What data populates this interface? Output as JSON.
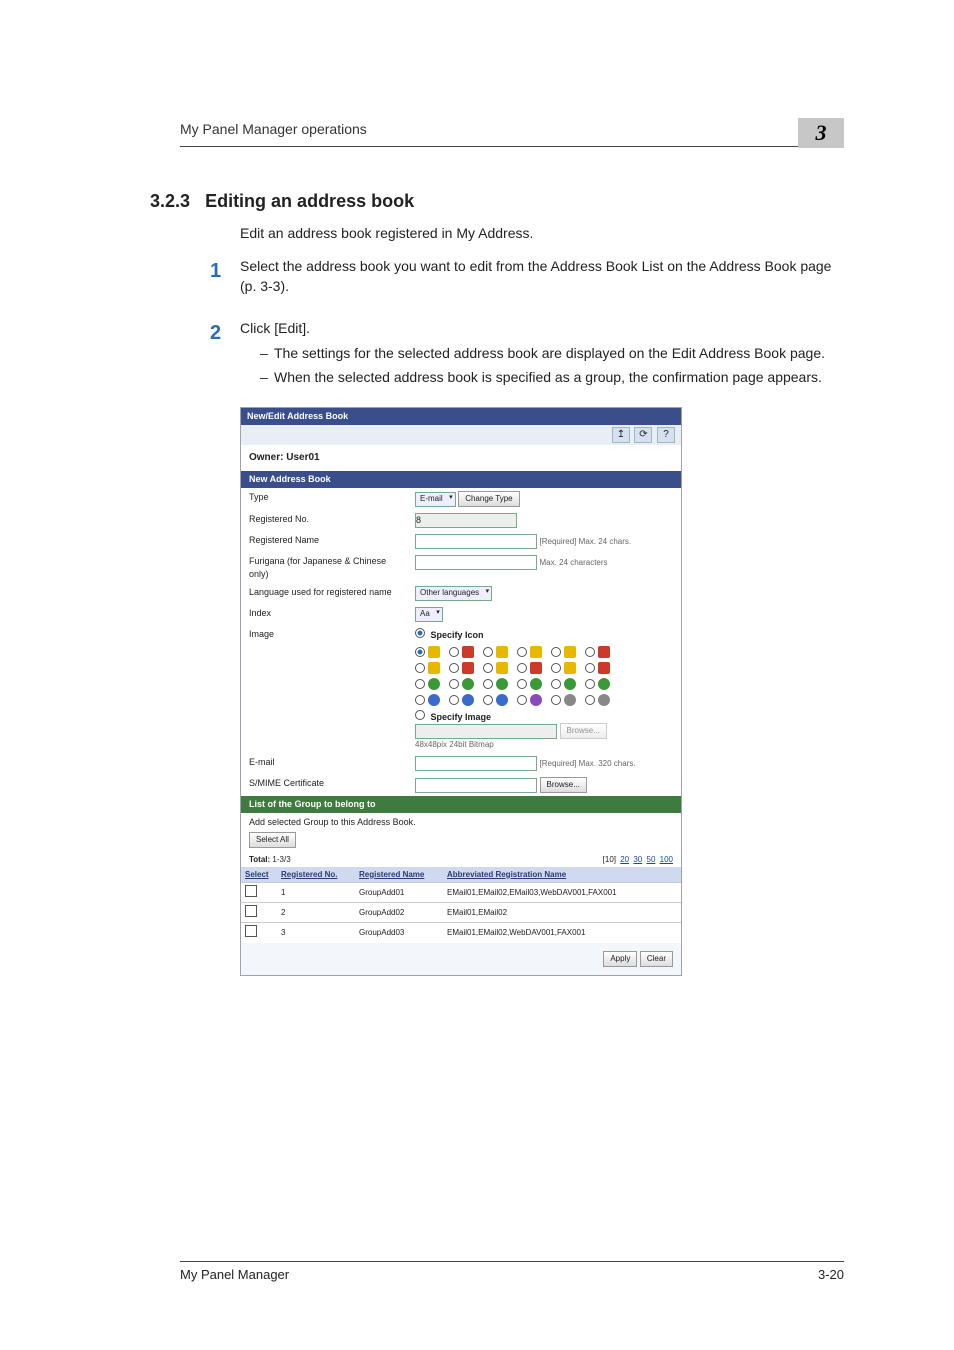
{
  "running_title": "My Panel Manager operations",
  "chapter_number": "3",
  "section_number": "3.2.3",
  "section_title": "Editing an address book",
  "intro": "Edit an address book registered in My Address.",
  "steps": [
    {
      "num": "1",
      "text": "Select the address book you want to edit from the Address Book List on the Address Book page (p. 3-3)."
    },
    {
      "num": "2",
      "text": "Click [Edit].",
      "sub": [
        "The settings for the selected address book are displayed on the Edit Address Book page.",
        "When the selected address book is specified as a group, the confirmation page appears."
      ]
    }
  ],
  "figure": {
    "window_title": "New/Edit Address Book",
    "owner_label": "Owner: User01",
    "panel1": "New Address Book",
    "type_label": "Type",
    "type_value": "E-mail",
    "change_type_btn": "Change Type",
    "regno_label": "Registered No.",
    "regno_value": "8",
    "regname_label": "Registered Name",
    "regname_hint": "[Required] Max. 24 chars.",
    "furigana_label": "Furigana (for Japanese & Chinese only)",
    "furigana_hint": "Max. 24 characters",
    "lang_label": "Language used for registered name",
    "lang_value": "Other languages",
    "index_label": "Index",
    "index_value": "Aa",
    "image_label": "Image",
    "specify_icon": "Specify Icon",
    "specify_image": "Specify Image",
    "image_hint": "48x48pix 24bit Bitmap",
    "browse_btn": "Browse...",
    "email_label": "E-mail",
    "email_hint": "[Required] Max. 320 chars.",
    "smime_label": "S/MIME Certificate",
    "panel2": "List of the Group to belong to",
    "panel2_sub": "Add selected Group to this Address Book.",
    "select_all": "Select All",
    "total_label": "Total:",
    "total_value": "1-3/3",
    "pager_current": "[10]",
    "pager_links": [
      "20",
      "30",
      "50",
      "100"
    ],
    "col_select": "Select",
    "col_regno": "Registered No.",
    "col_regname": "Registered Name",
    "col_abbrev": "Abbreviated Registration Name",
    "rows": [
      {
        "no": "1",
        "name": "GroupAdd01",
        "abbrev": "EMail01,EMail02,EMail03,WebDAV001,FAX001"
      },
      {
        "no": "2",
        "name": "GroupAdd02",
        "abbrev": "EMail01,EMail02"
      },
      {
        "no": "3",
        "name": "GroupAdd03",
        "abbrev": "EMail01,EMail02,WebDAV001,FAX001"
      }
    ],
    "apply_btn": "Apply",
    "clear_btn": "Clear"
  },
  "footer_left": "My Panel Manager",
  "footer_right": "3-20"
}
